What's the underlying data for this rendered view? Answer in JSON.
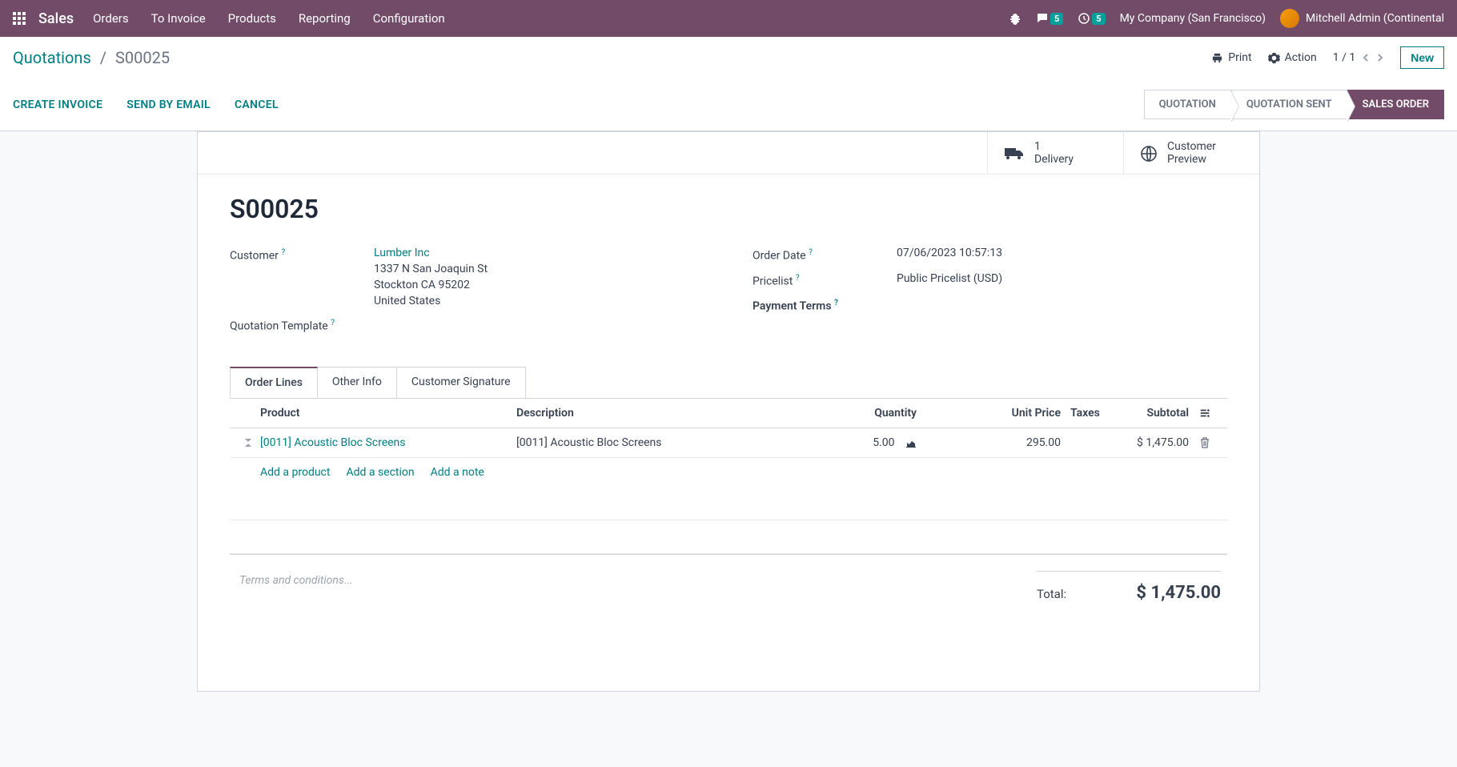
{
  "nav": {
    "brand": "Sales",
    "items": [
      "Orders",
      "To Invoice",
      "Products",
      "Reporting",
      "Configuration"
    ],
    "chat_badge": "5",
    "activity_badge": "5",
    "company": "My Company (San Francisco)",
    "user": "Mitchell Admin (Continental"
  },
  "breadcrumb": {
    "parent": "Quotations",
    "current": "S00025"
  },
  "controls": {
    "print": "Print",
    "action": "Action",
    "pager": "1 / 1",
    "new": "New"
  },
  "actions": {
    "create_invoice": "CREATE INVOICE",
    "send_email": "SEND BY EMAIL",
    "cancel": "CANCEL"
  },
  "status_steps": [
    "QUOTATION",
    "QUOTATION SENT",
    "SALES ORDER"
  ],
  "stat": {
    "delivery_count": "1",
    "delivery_label": "Delivery",
    "preview_top": "Customer",
    "preview_bot": "Preview"
  },
  "record": {
    "name": "S00025",
    "customer_label": "Customer",
    "customer_name": "Lumber Inc",
    "addr1": "1337 N San Joaquin St",
    "addr2": "Stockton CA 95202",
    "addr3": "United States",
    "template_label": "Quotation Template",
    "order_date_label": "Order Date",
    "order_date": "07/06/2023 10:57:13",
    "pricelist_label": "Pricelist",
    "pricelist": "Public Pricelist (USD)",
    "payment_terms_label": "Payment Terms"
  },
  "tabs": {
    "order_lines": "Order Lines",
    "other_info": "Other Info",
    "signature": "Customer Signature"
  },
  "grid": {
    "h_product": "Product",
    "h_desc": "Description",
    "h_qty": "Quantity",
    "h_unit": "Unit Price",
    "h_taxes": "Taxes",
    "h_sub": "Subtotal",
    "row": {
      "product": "[0011] Acoustic Bloc Screens",
      "desc": "[0011] Acoustic Bloc Screens",
      "qty": "5.00",
      "unit": "295.00",
      "sub": "$ 1,475.00"
    },
    "add_product": "Add a product",
    "add_section": "Add a section",
    "add_note": "Add a note"
  },
  "footer": {
    "terms_placeholder": "Terms and conditions...",
    "total_label": "Total:",
    "total_val": "$ 1,475.00"
  }
}
